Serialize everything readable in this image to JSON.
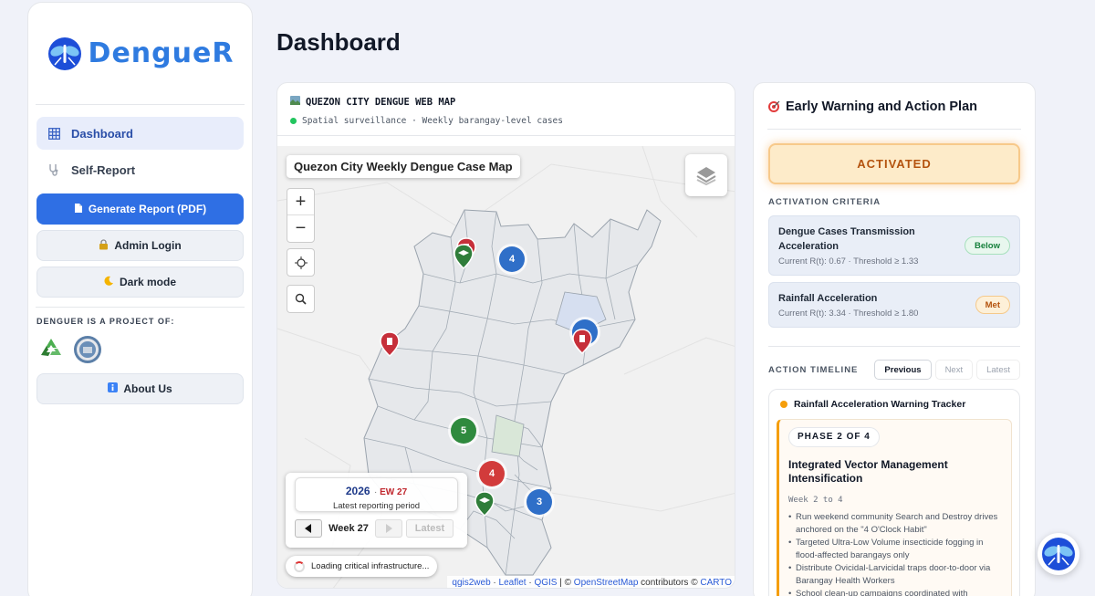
{
  "brand": {
    "name": "DengueR"
  },
  "sidebar": {
    "nav": [
      {
        "label": "Dashboard",
        "icon": "grid-icon"
      },
      {
        "label": "Self-Report",
        "icon": "stethoscope-icon"
      }
    ],
    "generate_label": "Generate Report (PDF)",
    "admin_label": "Admin Login",
    "dark_label": "Dark mode",
    "project_label": "DENGUER IS A PROJECT OF:",
    "about_label": "About Us"
  },
  "page": {
    "title": "Dashboard"
  },
  "map": {
    "card_title": "QUEZON CITY DENGUE WEB MAP",
    "card_subtitle": "Spatial surveillance · Weekly barangay-level cases",
    "map_title": "Quezon City Weekly Dengue Case Map",
    "clusters": [
      {
        "count": "4",
        "color": "blue"
      },
      {
        "count": "5",
        "color": "green"
      },
      {
        "count": "4",
        "color": "red"
      },
      {
        "count": "3",
        "color": "blue"
      }
    ],
    "year": "2026",
    "ew_label": "EW 27",
    "period_label": "Latest reporting period",
    "week_label": "Week 27",
    "latest_btn": "Latest",
    "loading_text": "Loading critical infrastructure...",
    "attribution": {
      "qgis2web": "qgis2web",
      "leaflet": "Leaflet",
      "qgis": "QGIS",
      "osm": "OpenStreetMap",
      "carto": "CARTO",
      "sep1": " · ",
      "sep2": " | © ",
      "contributors": " contributors © "
    }
  },
  "early_warning": {
    "title": "Early Warning and Action Plan",
    "status": "ACTIVATED",
    "criteria_label": "ACTIVATION CRITERIA",
    "criteria": [
      {
        "name": "Dengue Cases Transmission Acceleration",
        "meta": "Current R(t): 0.67 · Threshold ≥ 1.33",
        "badge": "Below"
      },
      {
        "name": "Rainfall Acceleration",
        "meta": "Current R(t): 3.34 · Threshold ≥ 1.80",
        "badge": "Met"
      }
    ],
    "timeline_label": "ACTION TIMELINE",
    "timeline_buttons": [
      "Previous",
      "Next",
      "Latest"
    ],
    "tracker_title": "Rainfall Acceleration Warning Tracker",
    "phase_label": "PHASE 2 OF 4",
    "phase_title": "Integrated Vector Management Intensification",
    "phase_weeks": "Week 2 to 4",
    "actions": [
      "Run weekend community Search and Destroy drives anchored on the \"4 O'Clock Habit\"",
      "Targeted Ultra-Low Volume insecticide fogging in flood-affected barangays only",
      "Distribute Ovicidal-Larvicidal traps door-to-door via Barangay Health Workers",
      "School clean-up campaigns coordinated with"
    ]
  },
  "colors": {
    "accent": "#2f6fe4",
    "activated_bg": "#fdebc9",
    "activated_text": "#b4530e"
  }
}
